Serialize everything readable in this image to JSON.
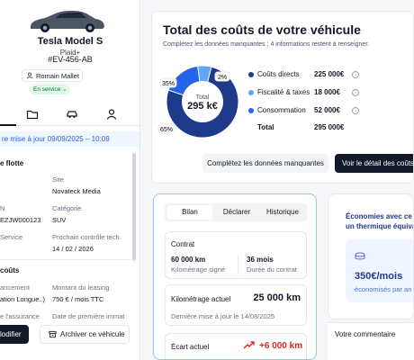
{
  "vehicle": {
    "name": "Tesla Model S",
    "version": "Plaid+",
    "plate": "#EV-456-AB",
    "driver": "Romain Mallet",
    "status": "En service"
  },
  "sidebar": {
    "tabs": [
      "info-icon",
      "folder-icon",
      "car-icon",
      "user-icon"
    ],
    "update_banner": "re mise à jour 09/09/2025 – 10:09",
    "fleet_title": "e flotte",
    "fields": [
      {
        "label": "Site",
        "value": "Novateck Media"
      },
      {
        "label": "N",
        "value": ""
      },
      {
        "label": "Catégorie",
        "value": "SUV"
      },
      {
        "label": "",
        "value": "EZJW000123"
      },
      {
        "label": "Service",
        "value": ""
      },
      {
        "label": "Prochain contrôle tech.",
        "value": "14 / 02 / 2026"
      }
    ],
    "costs_title": "coûts",
    "cost_fields": [
      {
        "label": "ancement",
        "value": "ation Longue..)"
      },
      {
        "label": "Montant du leasing",
        "value": "750 € / mois TTC"
      },
      {
        "label": "e l'assurance",
        "value": ""
      },
      {
        "label": "Date de première immat",
        "value": ""
      }
    ],
    "edit_button": "lodifier",
    "archive_button": "Archiver ce véhicule"
  },
  "costs": {
    "title": "Total des coûts de votre véhicule",
    "subtitle": "Complétez les données manquantes : 4 informations restent à renseigner.",
    "donut_label": "Total",
    "donut_value": "295 k€",
    "pct_labels": [
      "65%",
      "35%",
      "2%"
    ],
    "rows": [
      {
        "label": "Coûts directs",
        "value": "225 000€",
        "color": "#1e3a8a"
      },
      {
        "label": "Fiscalité & taxes",
        "value": "18 000€",
        "color": "#60a5fa"
      },
      {
        "label": "Consommation",
        "value": "52 000€",
        "color": "#2563eb"
      }
    ],
    "total_label": "Total",
    "total_value": "295 000€",
    "complete_button": "Complétez les données manquantes",
    "detail_button": "Voir le détail des coûts"
  },
  "chart_data": {
    "type": "pie",
    "categories": [
      "Coûts directs",
      "Consommation",
      "Fiscalité & taxes"
    ],
    "values": [
      225000,
      52000,
      18000
    ],
    "percent_labels": [
      65,
      35,
      2
    ]
  },
  "bilan": {
    "tabs": [
      "Bilan",
      "Déclarer",
      "Historique"
    ],
    "contract_title": "Contrat",
    "km_value": "60 000 km",
    "km_label": "Kilométrage signé",
    "months_value": "36 mois",
    "months_label": "Durée du contrat",
    "current_km_label": "Kilométrage actuel",
    "current_km_value": "25 000 km",
    "last_update": "Dernière mise à jour le 14/08/2025",
    "gap_label": "Écart actuel",
    "gap_value": "+6 000 km"
  },
  "savings": {
    "title_line1": "Économies avec ce",
    "title_line2": "un thermique équiva",
    "amount": "350€/mois",
    "caption": "économisés par an",
    "comment_title": "Votre commentaire"
  }
}
